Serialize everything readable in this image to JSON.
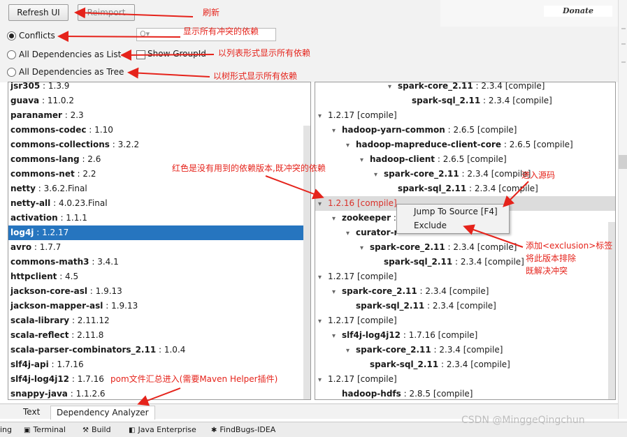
{
  "toolbar": {
    "refresh_label": "Refresh UI",
    "reimport_label": "Reimport",
    "donate_label": "Donate"
  },
  "options": {
    "conflicts": "Conflicts",
    "all_list": "All Dependencies as List",
    "all_tree": "All Dependencies as Tree",
    "show_groupid": "Show GroupId",
    "search_placeholder": "Q▾"
  },
  "left_list": [
    {
      "name": "jsr305",
      "version": "1.3.9"
    },
    {
      "name": "guava",
      "version": "11.0.2"
    },
    {
      "name": "paranamer",
      "version": "2.3"
    },
    {
      "name": "commons-codec",
      "version": "1.10"
    },
    {
      "name": "commons-collections",
      "version": "3.2.2"
    },
    {
      "name": "commons-lang",
      "version": "2.6"
    },
    {
      "name": "commons-net",
      "version": "2.2"
    },
    {
      "name": "netty",
      "version": "3.6.2.Final"
    },
    {
      "name": "netty-all",
      "version": "4.0.23.Final"
    },
    {
      "name": "activation",
      "version": "1.1.1"
    },
    {
      "name": "log4j",
      "version": "1.2.17"
    },
    {
      "name": "avro",
      "version": "1.7.7"
    },
    {
      "name": "commons-math3",
      "version": "3.4.1"
    },
    {
      "name": "httpclient",
      "version": "4.5"
    },
    {
      "name": "jackson-core-asl",
      "version": "1.9.13"
    },
    {
      "name": "jackson-mapper-asl",
      "version": "1.9.13"
    },
    {
      "name": "scala-library",
      "version": "2.11.12"
    },
    {
      "name": "scala-reflect",
      "version": "2.11.8"
    },
    {
      "name": "scala-parser-combinators_2.11",
      "version": "1.0.4"
    },
    {
      "name": "slf4j-api",
      "version": "1.7.16"
    },
    {
      "name": "slf4j-log4j12",
      "version": "1.7.16"
    },
    {
      "name": "snappy-java",
      "version": "1.1.2.6"
    }
  ],
  "selected_index": 10,
  "tree": [
    {
      "depth": 5,
      "toggle": "▾",
      "name": "spark-core_2.11",
      "rest": " : 2.3.4 [compile]"
    },
    {
      "depth": 6,
      "toggle": "",
      "name": "spark-sql_2.11",
      "rest": " : 2.3.4 [compile]"
    },
    {
      "depth": 0,
      "toggle": "▾",
      "name": "",
      "rest": "1.2.17 [compile]"
    },
    {
      "depth": 1,
      "toggle": "▾",
      "name": "hadoop-yarn-common",
      "rest": " : 2.6.5 [compile]"
    },
    {
      "depth": 2,
      "toggle": "▾",
      "name": "hadoop-mapreduce-client-core",
      "rest": " : 2.6.5 [compile]"
    },
    {
      "depth": 3,
      "toggle": "▾",
      "name": "hadoop-client",
      "rest": " : 2.6.5 [compile]"
    },
    {
      "depth": 4,
      "toggle": "▾",
      "name": "spark-core_2.11",
      "rest": " : 2.3.4 [compile]"
    },
    {
      "depth": 5,
      "toggle": "",
      "name": "spark-sql_2.11",
      "rest": " : 2.3.4 [compile]"
    },
    {
      "depth": 0,
      "toggle": "▾",
      "name": "",
      "rest": "1.2.16 [compile]",
      "conflict": true,
      "highlight": true
    },
    {
      "depth": 1,
      "toggle": "▾",
      "name": "zookeeper",
      "rest": " : "
    },
    {
      "depth": 2,
      "toggle": "▾",
      "name": "curator-r",
      "rest": ""
    },
    {
      "depth": 3,
      "toggle": "▾",
      "name": "spark-core_2.11",
      "rest": " : 2.3.4 [compile]"
    },
    {
      "depth": 4,
      "toggle": "",
      "name": "spark-sql_2.11",
      "rest": " : 2.3.4 [compile]"
    },
    {
      "depth": 0,
      "toggle": "▾",
      "name": "",
      "rest": "1.2.17 [compile]"
    },
    {
      "depth": 1,
      "toggle": "▾",
      "name": "spark-core_2.11",
      "rest": " : 2.3.4 [compile]"
    },
    {
      "depth": 2,
      "toggle": "",
      "name": "spark-sql_2.11",
      "rest": " : 2.3.4 [compile]"
    },
    {
      "depth": 0,
      "toggle": "▾",
      "name": "",
      "rest": "1.2.17 [compile]"
    },
    {
      "depth": 1,
      "toggle": "▾",
      "name": "slf4j-log4j12",
      "rest": " : 1.7.16 [compile]"
    },
    {
      "depth": 2,
      "toggle": "▾",
      "name": "spark-core_2.11",
      "rest": " : 2.3.4 [compile]"
    },
    {
      "depth": 3,
      "toggle": "",
      "name": "spark-sql_2.11",
      "rest": " : 2.3.4 [compile]"
    },
    {
      "depth": 0,
      "toggle": "▾",
      "name": "",
      "rest": "1.2.17 [compile]"
    },
    {
      "depth": 1,
      "toggle": "",
      "name": "hadoop-hdfs",
      "rest": " : 2.8.5 [compile]"
    }
  ],
  "context_menu": {
    "jump": "Jump To Source [F4]",
    "exclude": "Exclude"
  },
  "bottom_tabs": {
    "text": "Text",
    "dependency_analyzer": "Dependency Analyzer"
  },
  "statusbar": {
    "item0": "ing",
    "terminal": "Terminal",
    "build": "Build",
    "java_enterprise": "Java Enterprise",
    "findbugs": "FindBugs-IDEA"
  },
  "watermark": "CSDN @MinggeQingchun",
  "annotations": {
    "refresh": "刷新",
    "conflicts": "显示所有冲突的依赖",
    "list": "以列表形式显示所有依赖",
    "tree": "以树形式显示所有依赖",
    "red_note": "红色是没有用到的依赖版本,既冲突的依赖",
    "source": "进入源码",
    "exclusion_1": "添加<exclusion>标签",
    "exclusion_2": "将此版本排除",
    "exclusion_3": "既解决冲突",
    "pom": "pom文件汇总进入(需要Maven Helper插件)"
  },
  "colors": {
    "selection": "#2675bf",
    "conflict": "#d9312a",
    "annotation": "#e5231b"
  }
}
